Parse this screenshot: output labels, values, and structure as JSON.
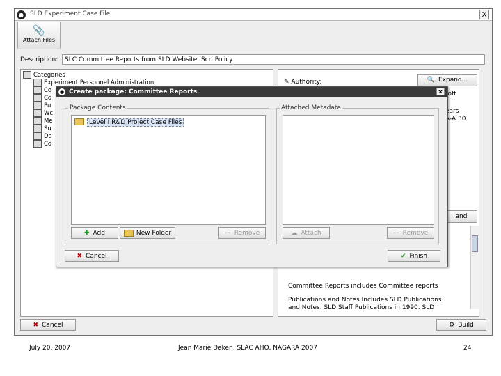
{
  "window": {
    "title": "SLD Experiment Case File",
    "close_label": "X",
    "toolbar": {
      "attach_label": "Attach Files"
    },
    "description_label": "Description:",
    "description_value": "SLC Committee Reports from SLD Website. Scrl Policy",
    "categories": {
      "root_label": "Categories",
      "items": [
        "Experiment Personnel Administration",
        "Co",
        "Co",
        "Pu",
        "Wc",
        "Me",
        "Su",
        "Da",
        "Co"
      ]
    },
    "authority": {
      "label": "Authority:",
      "expand_label": "Expand...",
      "snippets": [
        "toff",
        "ears",
        "A-A 30"
      ],
      "expand_label_2": "and"
    },
    "info_lines": [
      "Committee Reports includes Committee reports",
      "Publications and Notes Includes SLD Publications",
      "and Notes. SLD Staff Publications in 1990. SLD"
    ],
    "cancel_label": "Cancel",
    "build_label": "Build"
  },
  "dialog": {
    "title": "Create package: Committee Reports",
    "close_label": "x",
    "package_contents": {
      "title": "Package Contents",
      "items": [
        "Level I R&D Project Case Files"
      ],
      "add_label": "Add",
      "new_folder_label": "New Folder",
      "remove_label": "Remove"
    },
    "attached_metadata": {
      "title": "Attached Metadata",
      "attach_label": "Attach",
      "remove_label": "Remove"
    },
    "cancel_label": "Cancel",
    "finish_label": "Finish"
  },
  "footer": {
    "date": "July 20, 2007",
    "author": "Jean Marie Deken, SLAC AHO, NAGARA 2007",
    "page": "24"
  }
}
